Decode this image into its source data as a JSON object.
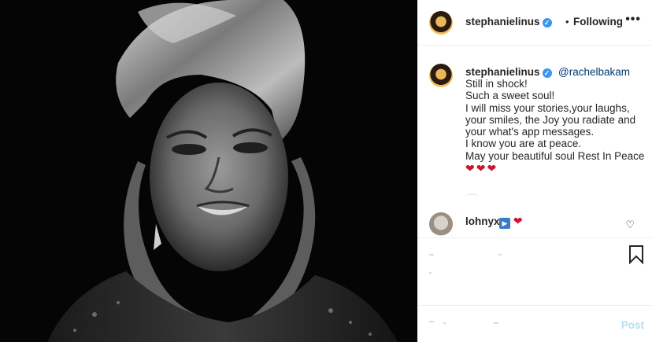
{
  "header": {
    "username": "stephanielinus",
    "separator": "•",
    "follow_status": "Following",
    "more_label": "•••"
  },
  "caption": {
    "username": "stephanielinus",
    "mention": "@rachelbakam",
    "lines": [
      "Still in shock!",
      "Such a sweet soul!",
      "I will miss your stories,your laughs,",
      "your smiles, the Joy you radiate and",
      "your what's app messages.",
      "I know you are at peace.",
      "May your beautiful soul Rest In Peace"
    ],
    "hearts": "❤❤❤",
    "trailing": "...."
  },
  "comment": {
    "username": "lohnyx",
    "play_emoji": "▶",
    "heart": "❤"
  },
  "composer": {
    "post_label": "Post"
  },
  "colors": {
    "accent": "#3897f0",
    "mention": "#00376b",
    "heart": "#cc1430",
    "post_disabled": "#b2dffc"
  },
  "icons": {
    "verified": "verified-badge-icon",
    "like": "heart-outline-icon",
    "bookmark": "bookmark-icon",
    "more": "more-options-icon"
  }
}
